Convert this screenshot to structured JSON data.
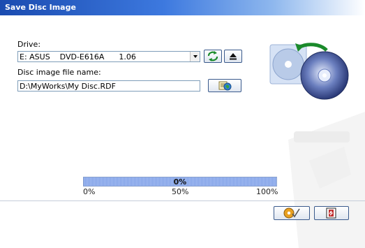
{
  "window": {
    "title": "Save Disc Image"
  },
  "drive": {
    "label": "Drive:",
    "selected": "E: ASUS    DVD-E616A      1.06",
    "refresh_icon": "refresh-icon",
    "eject_icon": "eject-icon"
  },
  "image_file": {
    "label": "Disc image file name:",
    "value": "D:\\MyWorks\\My Disc.RDF",
    "browse_icon": "browse-folder-icon"
  },
  "progress": {
    "value_percent": 0,
    "text": "0%",
    "ticks": [
      "0%",
      "50%",
      "100%"
    ],
    "fill_color": "#7d9ee6"
  },
  "buttons": {
    "save_icon": "save-disc-icon",
    "exit_icon": "exit-icon"
  },
  "colors": {
    "title_start": "#1a4bb0",
    "title_end": "#ffffff",
    "accent": "#3d79df"
  }
}
